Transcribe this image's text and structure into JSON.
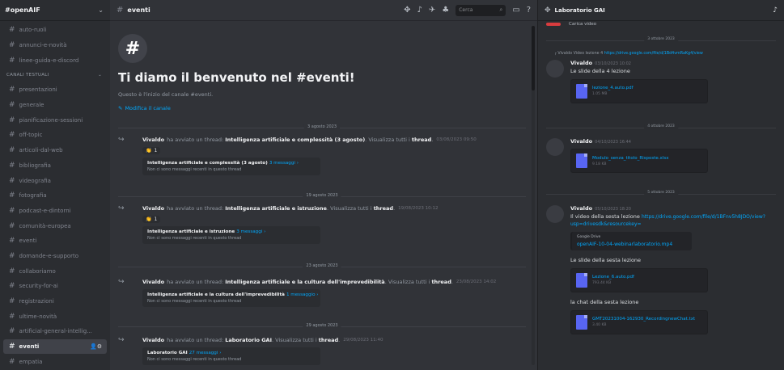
{
  "sidebar": {
    "server_name": "#openAIF",
    "top_channels": [
      "auto-ruoli",
      "annunci-e-novità",
      "linee-guida-e-discord"
    ],
    "category": "CANALI TESTUALI",
    "channels": [
      "presentazioni",
      "generale",
      "pianificazione-sessioni",
      "off-topic",
      "articoli-dal-web",
      "bibliografia",
      "videografia",
      "fotografia",
      "podcast-e-dintorni",
      "comunità-europea",
      "eventi",
      "domande-e-supporto",
      "collaboriamo",
      "security-for-ai",
      "registrazioni",
      "ultime-novità",
      "artificial-general-intellig...",
      "eventi",
      "empatia"
    ],
    "active_channel": "eventi",
    "active_tools": "👤⚙"
  },
  "main": {
    "channel_name": "eventi",
    "search_placeholder": "Cerca",
    "welcome": {
      "badge": "#",
      "title": "Ti diamo il benvenuto nel #eventi!",
      "subtitle": "Questo è l'inizio del canale #eventi.",
      "edit_label": "Modifica il canale"
    },
    "events": [
      {
        "date": "3 agosto 2023",
        "user": "Vivaldo",
        "action": "ha avviato un thread:",
        "thread": "Intelligenza artificiale e complessità (3 agosto)",
        "see_all": "Visualizza tutti i",
        "threads_word": "thread",
        "time": "03/08/2023 09:50",
        "reaction": "1",
        "card_title": "Intelligenza artificiale e complessità (3 agosto)",
        "card_count": "3 messaggi ›",
        "card_sub": "Non ci sono messaggi recenti in questo thread"
      },
      {
        "date": "19 agosto 2023",
        "user": "Vivaldo",
        "action": "ha avviato un thread:",
        "thread": "Intelligenza artificiale e istruzione",
        "see_all": "Visualizza tutti i",
        "threads_word": "thread",
        "time": "19/08/2023 10:12",
        "reaction": "1",
        "card_title": "Intelligenza artificiale e istruzione",
        "card_count": "3 messaggi ›",
        "card_sub": "Non ci sono messaggi recenti in questo thread"
      },
      {
        "date": "23 agosto 2023",
        "user": "Vivaldo",
        "action": "ha avviato un thread:",
        "thread": "Intelligenza artificiale e la cultura dell'imprevedibilità",
        "see_all": "Visualizza tutti i",
        "threads_word": "thread",
        "time": "23/08/2023 14:02",
        "reaction": "",
        "card_title": "Intelligenza artificiale e la cultura dell'imprevedibilità",
        "card_count": "1 messaggio ›",
        "card_sub": "Non ci sono messaggi recenti in questo thread"
      },
      {
        "date": "29 agosto 2023",
        "user": "Vivaldo",
        "action": "ha avviato un thread:",
        "thread": "Laboratorio GAI",
        "see_all": "Visualizza tutti i",
        "threads_word": "thread",
        "time": "29/08/2023 11:40",
        "reaction": "",
        "card_title": "Laboratorio GAI",
        "card_count": "27 messaggi ›",
        "card_sub": "Non ci sono messaggi recenti in questo thread"
      }
    ]
  },
  "panel": {
    "title": "Laboratorio GAI",
    "top_snippet": "Carica video",
    "date1": "3 ottobre 2023",
    "reply": {
      "user": "Vivaldo",
      "text": "Video lezione 4",
      "link": "https://drive.google.com/file/d/1Bd4vmRaKg4/view"
    },
    "msg1": {
      "user": "Vivaldo",
      "time": "03/10/2023 10:02",
      "text": "Le slide della 4 lezione",
      "file": "lezione_4.auto.pdf",
      "size": "1.05 MB"
    },
    "date2": "4 ottobre 2023",
    "msg2": {
      "user": "Vivaldo",
      "time": "04/10/2023 16:44",
      "file": "Modulo_senza_titolo_Risposte.xlsx",
      "size": "9.18 KB"
    },
    "date3": "5 ottobre 2023",
    "msg3": {
      "user": "Vivaldo",
      "time": "05/10/2023 18:20",
      "text": "Il video della sesta lezione",
      "link": "https://drive.google.com/file/d/1BFnv5h8JDO/view?usp=drivesdk&resourcekey=",
      "embed_source": "Google Drive",
      "embed_title": "openAIF-10-04-webinarlaboratorio.mp4",
      "text2": "Le slide della sesta lezione",
      "file2": "Lezione_6.auto.pdf",
      "size2": "793.44 KB",
      "text3": "la chat della sesta lezione",
      "file3": "GMT20231004-162930_RecordingnewChat.txt",
      "size3": "3.40 KB"
    }
  },
  "colors": {
    "sidebar_bg": "#2b2d31",
    "main_bg": "#313338",
    "link": "#00a8fc",
    "accent": "#5865f2"
  }
}
